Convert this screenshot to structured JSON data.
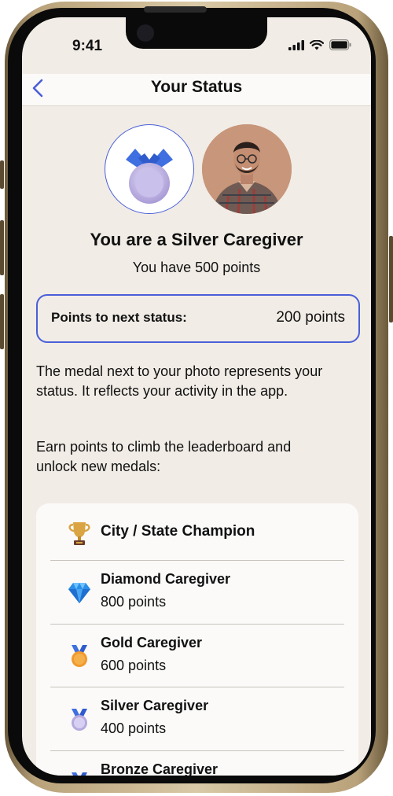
{
  "status_bar": {
    "time": "9:41"
  },
  "nav": {
    "title": "Your Status",
    "back_label": "Back"
  },
  "profile": {
    "headline": "You are a Silver Caregiver",
    "points_text": "You have 500 points"
  },
  "next_status": {
    "label": "Points to next status:",
    "value": "200 points"
  },
  "description": {
    "paragraph1": "The medal next to your photo represents your status. It reflects your activity in the app.",
    "paragraph2": "Earn points to climb the leaderboard and unlock new medals:"
  },
  "tiers": [
    {
      "name": "City / State Champion",
      "points": "",
      "icon": "trophy-icon"
    },
    {
      "name": "Diamond Caregiver",
      "points": "800 points",
      "icon": "diamond-icon"
    },
    {
      "name": "Gold Caregiver",
      "points": "600 points",
      "icon": "gold-medal-icon"
    },
    {
      "name": "Silver Caregiver",
      "points": "400 points",
      "icon": "silver-medal-icon"
    },
    {
      "name": "Bronze Caregiver",
      "points": "",
      "icon": "bronze-medal-icon"
    }
  ],
  "colors": {
    "accent": "#4a5fd8",
    "background": "#f1ece6",
    "card": "#fbfaf9"
  }
}
